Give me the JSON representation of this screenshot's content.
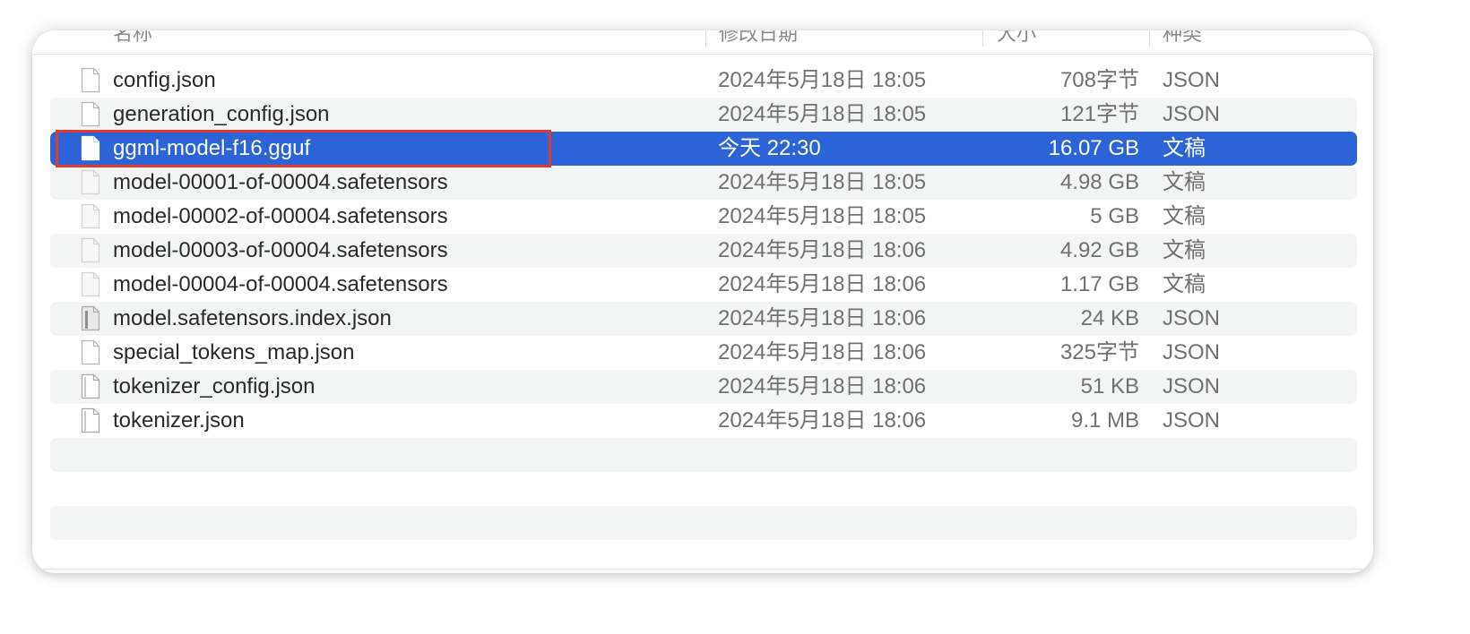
{
  "header": {
    "name_label": "名称",
    "date_label": "修改日期",
    "size_label": "大小",
    "kind_label": "种类"
  },
  "files": [
    {
      "name": "config.json",
      "date": "2024年5月18日 18:05",
      "size": "708字节",
      "kind": "JSON"
    },
    {
      "name": "generation_config.json",
      "date": "2024年5月18日 18:05",
      "size": "121字节",
      "kind": "JSON"
    },
    {
      "name": "ggml-model-f16.gguf",
      "date": "今天 22:30",
      "size": "16.07 GB",
      "kind": "文稿"
    },
    {
      "name": "model-00001-of-00004.safetensors",
      "date": "2024年5月18日 18:05",
      "size": "4.98 GB",
      "kind": "文稿"
    },
    {
      "name": "model-00002-of-00004.safetensors",
      "date": "2024年5月18日 18:05",
      "size": "5 GB",
      "kind": "文稿"
    },
    {
      "name": "model-00003-of-00004.safetensors",
      "date": "2024年5月18日 18:06",
      "size": "4.92 GB",
      "kind": "文稿"
    },
    {
      "name": "model-00004-of-00004.safetensors",
      "date": "2024年5月18日 18:06",
      "size": "1.17 GB",
      "kind": "文稿"
    },
    {
      "name": "model.safetensors.index.json",
      "date": "2024年5月18日 18:06",
      "size": "24 KB",
      "kind": "JSON"
    },
    {
      "name": "special_tokens_map.json",
      "date": "2024年5月18日 18:06",
      "size": "325字节",
      "kind": "JSON"
    },
    {
      "name": "tokenizer_config.json",
      "date": "2024年5月18日 18:06",
      "size": "51 KB",
      "kind": "JSON"
    },
    {
      "name": "tokenizer.json",
      "date": "2024年5月18日 18:06",
      "size": "9.1 MB",
      "kind": "JSON"
    }
  ],
  "selected_file": "ggml-model-f16.gguf",
  "colors": {
    "selection": "#2c64d8",
    "annotation_box": "#e03a2f",
    "alt_row": "#f3f4f4"
  },
  "icons": {
    "file": "document-icon",
    "sort": "chevron-up-icon"
  }
}
